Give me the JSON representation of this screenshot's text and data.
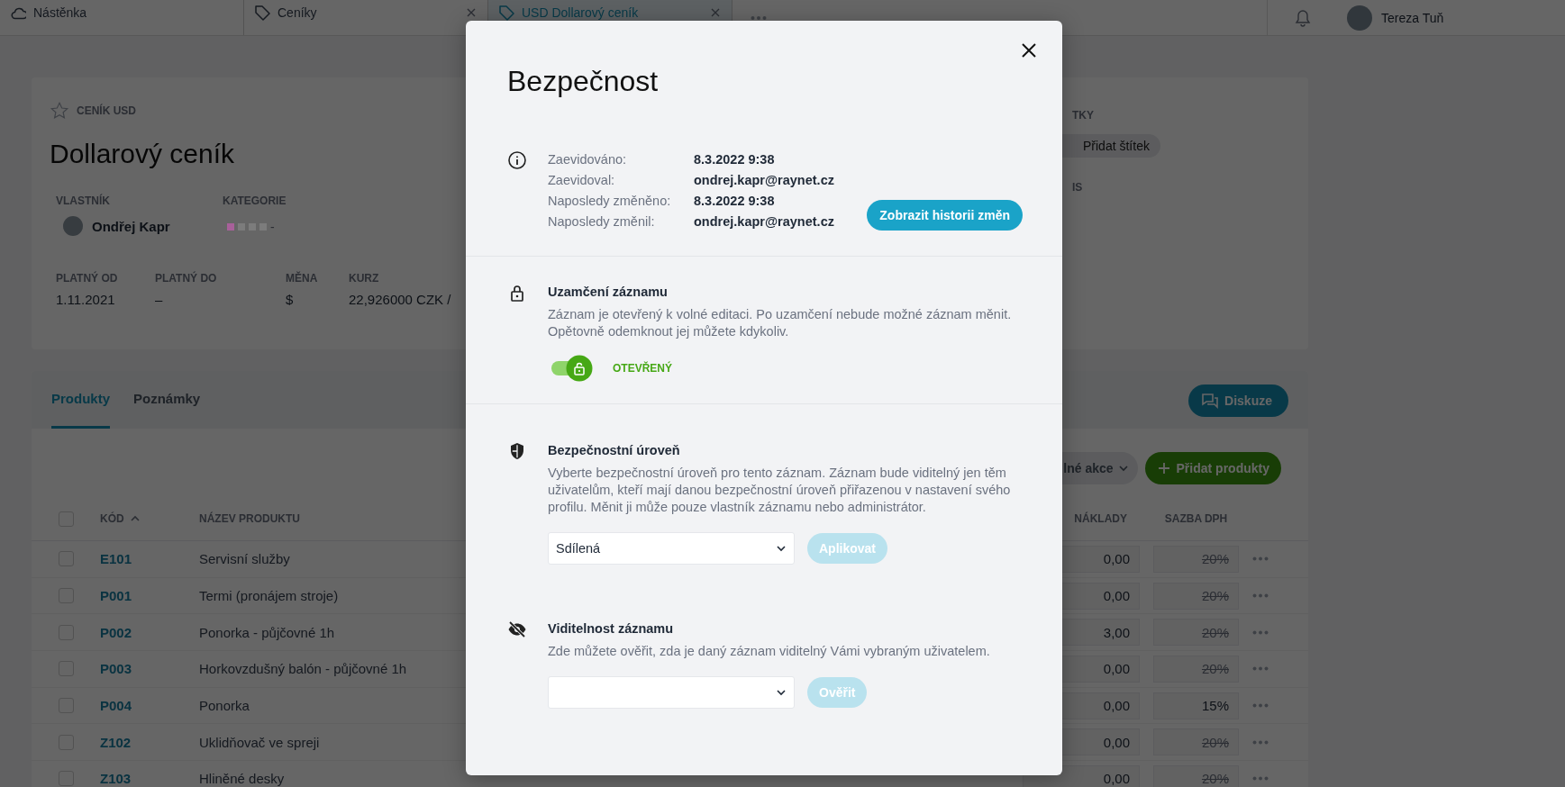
{
  "top_tabs": [
    {
      "label": "Nástěnka",
      "kind": "home",
      "closable": false,
      "selected": false
    },
    {
      "label": "Ceníky",
      "kind": "record",
      "closable": true,
      "selected": false
    },
    {
      "label": "USD Dollarový ceník",
      "kind": "record",
      "closable": true,
      "selected": true
    }
  ],
  "user": {
    "name": "Tereza Tuň"
  },
  "record": {
    "breadcrumb": "CENÍK USD",
    "starred": false,
    "title": "Dollarový ceník",
    "owner": {
      "label": "VLASTNÍK",
      "name": "Ondřej Kapr"
    },
    "category": {
      "label": "KATEGORIE",
      "dots": [
        {
          "color": "#a8609a"
        },
        {
          "color": "#7c7c7c"
        },
        {
          "color": "#7c7c7c"
        },
        {
          "color": "#7c7c7c"
        }
      ],
      "value": "-"
    },
    "fields": [
      {
        "label": "PLATNÝ OD",
        "value": "1.11.2021"
      },
      {
        "label": "PLATNÝ DO",
        "value": "–"
      },
      {
        "label": "MĚNA",
        "value": "$"
      },
      {
        "label": "KURZ",
        "value": "22,926000 CZK / "
      }
    ],
    "side": {
      "tags_label": "TKY",
      "tag_button": "Přidat štítek",
      "description_label": "IS"
    }
  },
  "content_tabs": [
    {
      "label": "Produkty",
      "selected": true
    },
    {
      "label": "Poznámky",
      "selected": false
    }
  ],
  "discussion_button": "Diskuze",
  "actions_dropdown": "lné akce",
  "add_products_button": "Přidat produkty",
  "table": {
    "columns": [
      "KÓD",
      "NÁZEV PRODUKTU",
      "NÁKLADY",
      "SAZBA DPH"
    ],
    "all_checked": false,
    "rows": [
      {
        "checked": false,
        "code": "E101",
        "name": "Servisní služby",
        "cost": "0,00",
        "vat": "20%",
        "vat_struck": true
      },
      {
        "checked": false,
        "code": "P001",
        "name": "Termi (pronájem stroje)",
        "cost": "0,00",
        "vat": "20%",
        "vat_struck": true
      },
      {
        "checked": false,
        "code": "P002",
        "name": "Ponorka - půjčovné 1h",
        "cost": "3,00",
        "vat": "20%",
        "vat_struck": true
      },
      {
        "checked": false,
        "code": "P003",
        "name": "Horkovzdušný balón - půjčovné 1h",
        "cost": "0,00",
        "vat": "20%",
        "vat_struck": true
      },
      {
        "checked": false,
        "code": "P004",
        "name": "Ponorka",
        "cost": "0,00",
        "vat": "15%",
        "vat_struck": false
      },
      {
        "checked": false,
        "code": "Z102",
        "name": "Uklidňovač ve spreji",
        "cost": "0,00",
        "vat": "20%",
        "vat_struck": true
      },
      {
        "checked": false,
        "code": "Z103",
        "name": "Hliněné desky",
        "cost": "0,00",
        "vat": "20%",
        "vat_struck": true
      }
    ]
  },
  "dialog": {
    "title": "Bezpečnost",
    "info": [
      {
        "label": "Zaevidováno:",
        "value": "8.3.2022 9:38"
      },
      {
        "label": "Zaevidoval:",
        "value": "ondrej.kapr@raynet.cz"
      },
      {
        "label": "Naposledy změněno:",
        "value": "8.3.2022 9:38"
      },
      {
        "label": "Naposledy změnil:",
        "value": "ondrej.kapr@raynet.cz"
      }
    ],
    "history_button": "Zobrazit historii změn",
    "lock": {
      "title": "Uzamčení záznamu",
      "description": "Záznam je otevřený k volné editaci. Po uzamčení nebude možné záznam měnit. Opětovně odemknout jej můžete kdykoliv.",
      "open": true,
      "state_label": "OTEVŘENÝ"
    },
    "security_level": {
      "title": "Bezpečnostní úroveň",
      "description": "Vyberte bezpečnostní úroveň pro tento záznam. Záznam bude viditelný jen těm uživatelům, kteří mají danou bezpečnostní úroveň přiřazenou v nastavení svého profilu. Měnit ji může pouze vlastník záznamu nebo administrátor.",
      "value": "Sdílená",
      "button": {
        "label": "Aplikovat",
        "disabled": true
      }
    },
    "visibility": {
      "title": "Viditelnost záznamu",
      "description": "Zde můžete ověřit, zda je daný záznam viditelný Vámi vybraným uživatelem.",
      "button": {
        "label": "Ověřit",
        "disabled": true
      }
    }
  }
}
